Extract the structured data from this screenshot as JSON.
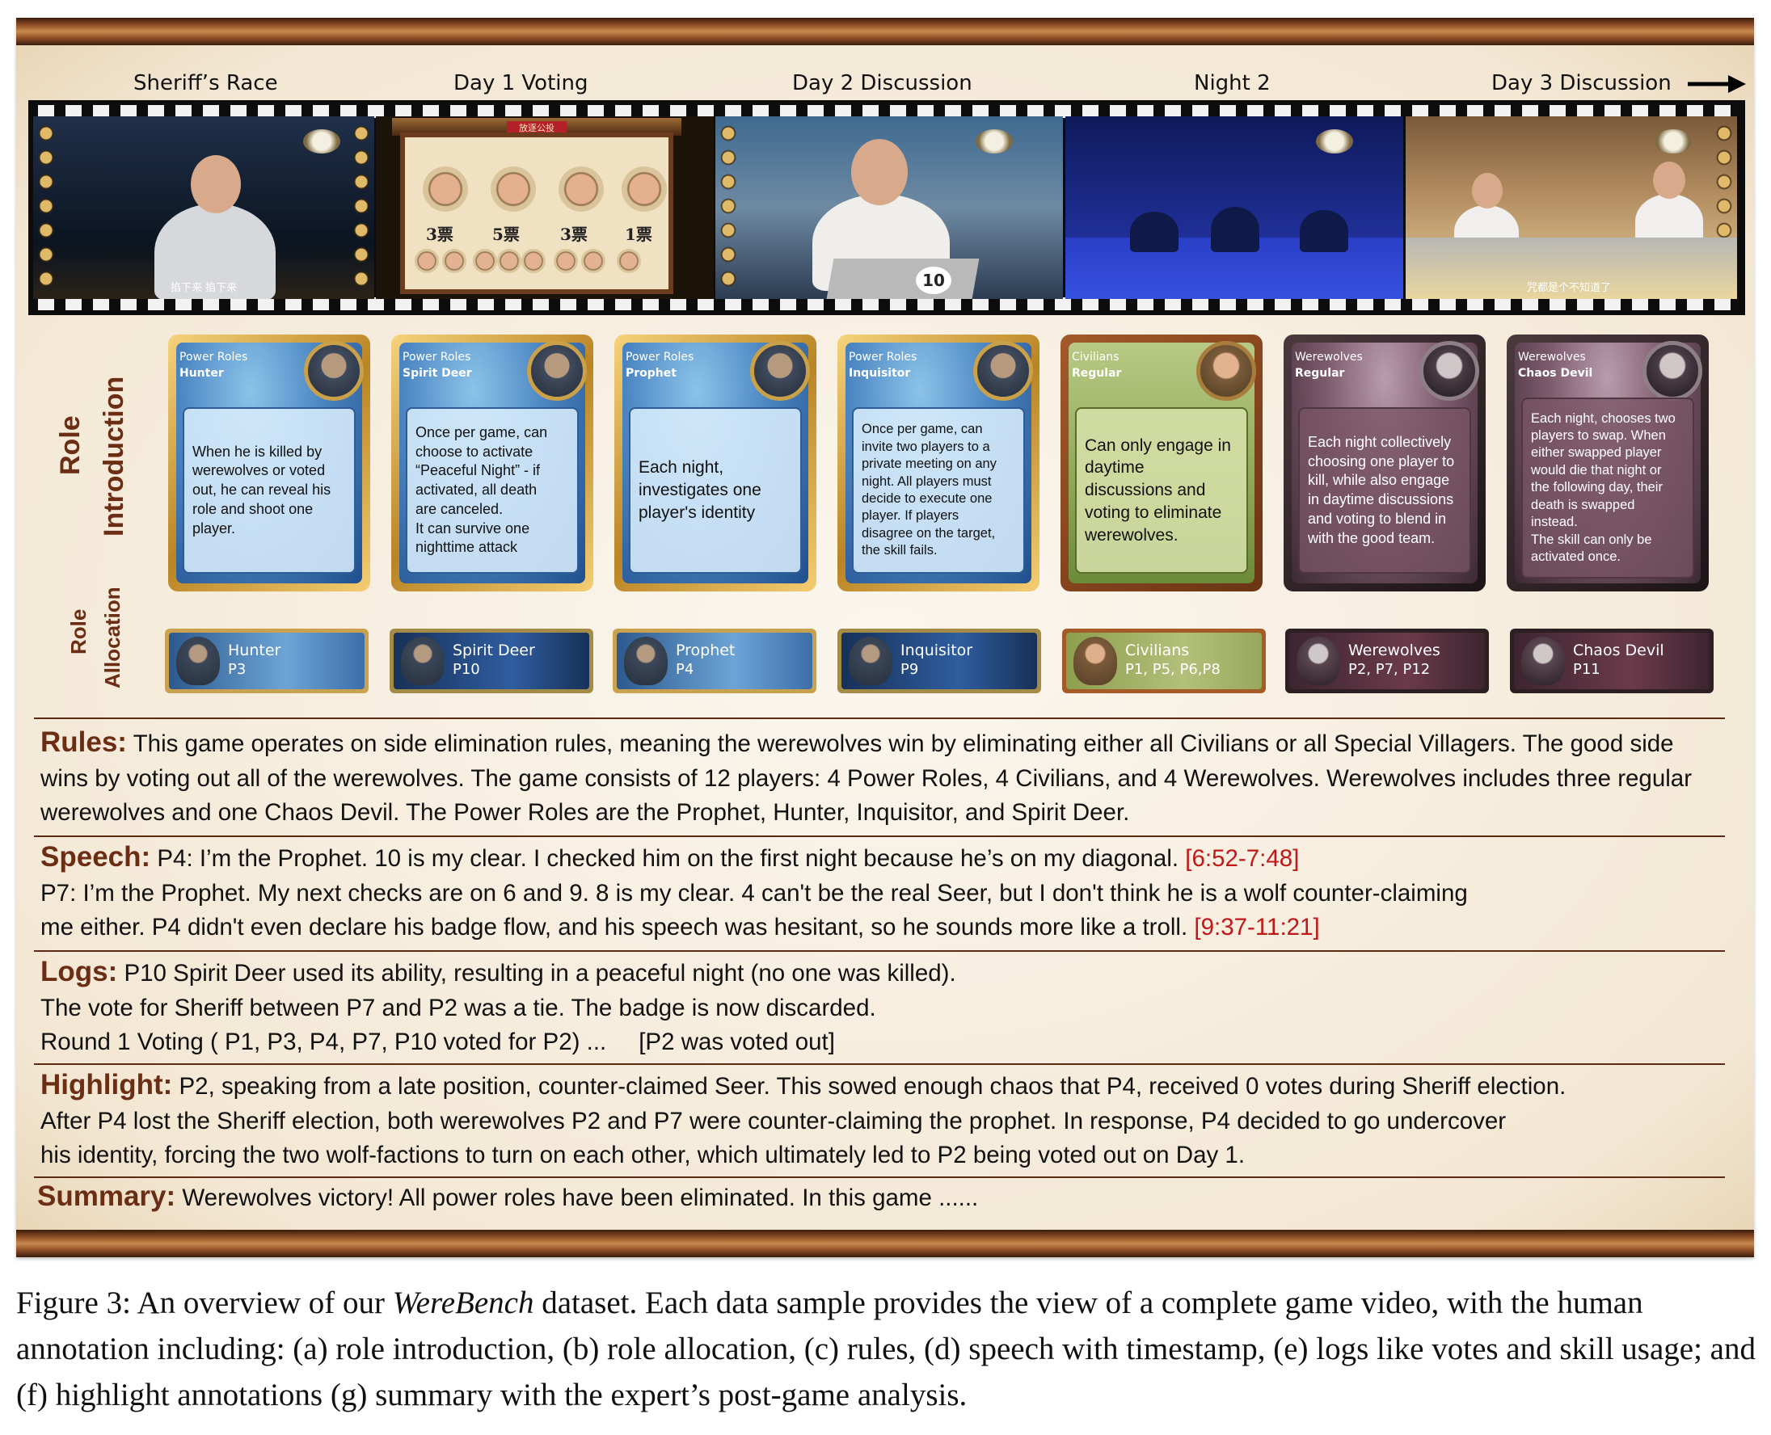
{
  "timeline": {
    "stages": [
      "Sheriff’s Race",
      "Day 1 Voting",
      "Day 2 Discussion",
      "Night 2",
      "Day 3 Discussion"
    ],
    "subtitle_text_shot1": "掐下来 掐下来",
    "subtitle_text_shot5": "咒都是个不知道了",
    "vote_board": {
      "sign": "放逐公投",
      "counts": [
        "3票",
        "5票",
        "3票",
        "1票"
      ]
    },
    "player_plate": "10"
  },
  "role_intro": {
    "label_line1": "Role",
    "label_line2": "Introduction",
    "cards": [
      {
        "category": "Power Roles",
        "name": "Hunter",
        "description": "When he is killed by\nwerewolves or voted\nout, he can reveal his\nrole and shoot one\nplayer.",
        "style": "gold"
      },
      {
        "category": "Power Roles",
        "name": "Spirit Deer",
        "description": "Once per game, can\nchoose to activate\n“Peaceful Night” - if\nactivated, all death\nare canceled.\nIt can survive one\nnighttime attack",
        "style": "gold"
      },
      {
        "category": "Power Roles",
        "name": "Prophet",
        "description": "Each night,\ninvestigates one\nplayer's identity",
        "style": "gold"
      },
      {
        "category": "Power Roles",
        "name": "Inquisitor",
        "description": "Once per game, can\ninvite two players to a\nprivate meeting on any\nnight. All players must\ndecide to execute one\nplayer.  If players\ndisagree on the target,\nthe skill fails.",
        "style": "gold"
      },
      {
        "category": "Civilians",
        "name": "Regular",
        "description": "Can only engage in\ndaytime\ndiscussions and\nvoting to eliminate\nwerewolves.",
        "style": "green"
      },
      {
        "category": "Werewolves",
        "name": "Regular",
        "description": "Each night collectively\nchoosing one player to\nkill, while also engage\nin daytime discussions\nand voting to blend in\nwith the good team.",
        "style": "dark"
      },
      {
        "category": "Werewolves",
        "name": "Chaos Devil",
        "description": "Each night, chooses two\nplayers to swap. When\neither swapped player\nwould die that night or\nthe following day, their\ndeath is swapped\ninstead.\nThe skill can only be\nactivated once.",
        "style": "dark"
      }
    ]
  },
  "role_allocation": {
    "label_line1": "Role",
    "label_line2": "Allocation",
    "chips": [
      {
        "name": "Hunter",
        "players": "P3"
      },
      {
        "name": "Spirit Deer",
        "players": "P10"
      },
      {
        "name": "Prophet",
        "players": "P4"
      },
      {
        "name": "Inquisitor",
        "players": "P9"
      },
      {
        "name": "Civilians",
        "players": "P1, P5, P6,P8"
      },
      {
        "name": "Werewolves",
        "players": "P2, P7, P12"
      },
      {
        "name": "Chaos Devil",
        "players": "P11"
      }
    ]
  },
  "rules": {
    "label": "Rules:",
    "text": "This game operates on side elimination rules, meaning the werewolves win by eliminating either all Civilians or all Special Villagers. The good side wins by voting out all of the werewolves. The game consists of 12 players: 4 Power Roles, 4 Civilians, and 4 Werewolves. Werewolves includes three regular werewolves and one Chaos Devil. The Power Roles are the Prophet, Hunter, Inquisitor, and Spirit Deer."
  },
  "speech": {
    "label": "Speech:",
    "line1": "P4: I’m the Prophet. 10 is my clear. I checked him on the first night because he’s on my diagonal.",
    "ts1": "[6:52-7:48]",
    "line2": "P7: I’m the Prophet. My next checks are on 6 and 9. 8 is my clear. 4 can't be the real Seer, but I don't think he is a wolf counter-claiming",
    "line3": "me either. P4 didn't even declare his badge flow, and his speech was hesitant, so he sounds more like a troll.",
    "ts2": "[9:37-11:21]"
  },
  "logs": {
    "label": "Logs:",
    "line1": "P10 Spirit Deer used its ability, resulting in a peaceful night (no one was killed).",
    "line2": "The vote for Sheriff between P7 and P2 was a tie. The badge is now discarded.",
    "line3": "Round 1 Voting ( P1, P3, P4, P7, P10 voted for P2) ...",
    "line3b": "[P2 was voted out]"
  },
  "highlight": {
    "label": "Highlight:",
    "line1": "P2, speaking from a late position, counter-claimed Seer. This sowed enough chaos that  P4, received 0 votes during Sheriff election.",
    "line2": "After P4 lost the Sheriff election, both werewolves  P2 and P7 were counter-claiming the prophet. In response,  P4 decided to go undercover",
    "line3": "his identity, forcing the two wolf-factions to turn on each other, which ultimately led to P2 being voted out on Day 1."
  },
  "summary": {
    "label": "Summary:",
    "text": "Werewolves victory! All power roles have been eliminated.  In this game ......"
  },
  "figure_caption": {
    "prefix": "Figure 3: An overview of our",
    "name": "WereBench",
    "rest": "dataset. Each data sample provides the view of a complete game video, with the human annotation including: (a) role introduction, (b) role allocation, (c) rules, (d) speech with timestamp, (e) logs like votes and skill usage; and (f) highlight annotations (g) summary with the expert’s post-game analysis."
  },
  "colors": {
    "section_label": "#6b2e14",
    "timestamp": "#c01818",
    "frame_wood": "#8b4b24"
  }
}
